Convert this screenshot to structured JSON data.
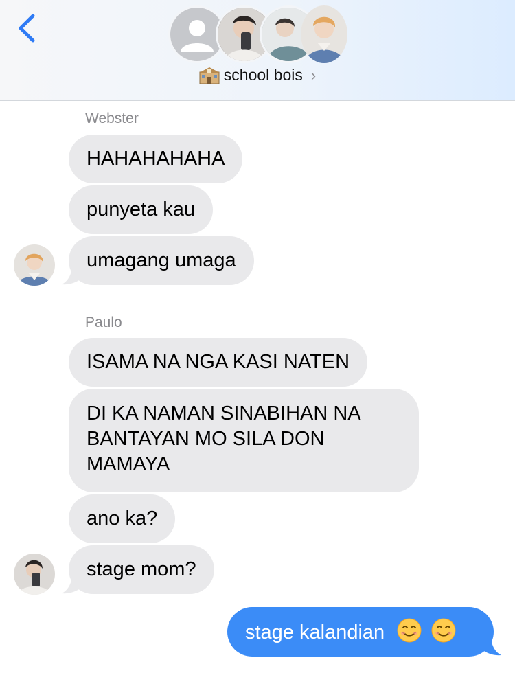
{
  "header": {
    "back_label": "Back",
    "group_name": "school bois",
    "group_icon": "school-building-icon"
  },
  "conversation": {
    "groups": [
      {
        "sender": "Webster",
        "messages": [
          "HAHAHAHAHA",
          "punyeta kau",
          "umagang umaga"
        ]
      },
      {
        "sender": "Paulo",
        "messages": [
          "ISAMA NA NGA KASI NATEN",
          "DI KA NAMAN SINABIHAN NA BANTAYAN MO SILA DON MAMAYA",
          "ano ka?",
          "stage mom?"
        ]
      }
    ],
    "outgoing": {
      "text": "stage kalandian",
      "emojis": [
        "smiling-face-icon",
        "smiling-face-icon"
      ]
    }
  },
  "colors": {
    "incoming_bubble": "#e9e9eb",
    "outgoing_bubble": "#3b8cf7",
    "accent": "#2f7bf5"
  }
}
